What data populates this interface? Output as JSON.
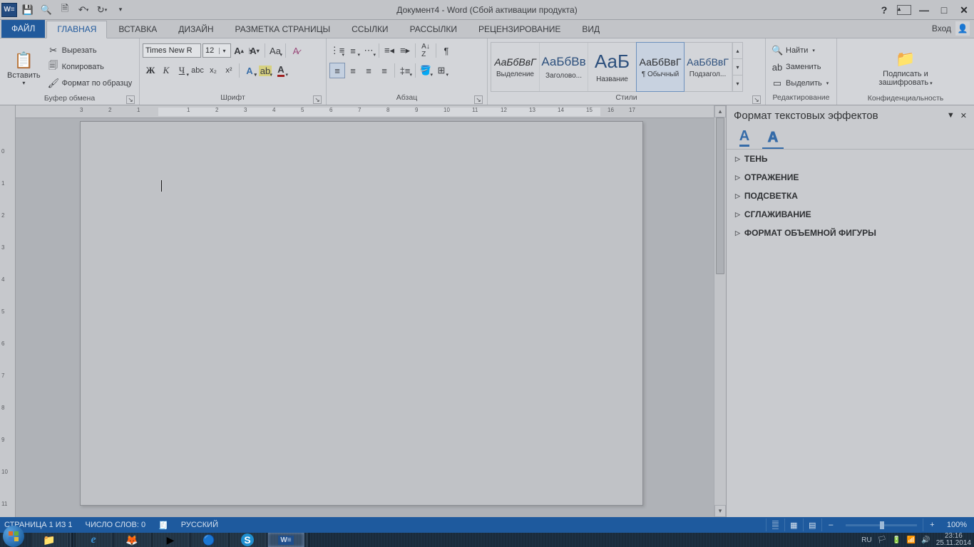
{
  "title": "Документ4 - Word (Сбой активации продукта)",
  "qat": {
    "save_tip": "Сохранить",
    "undo_tip": "Отменить",
    "redo_tip": "Повторить"
  },
  "tabs": {
    "file": "ФАЙЛ",
    "list": [
      "ГЛАВНАЯ",
      "ВСТАВКА",
      "ДИЗАЙН",
      "РАЗМЕТКА СТРАНИЦЫ",
      "ССЫЛКИ",
      "РАССЫЛКИ",
      "РЕЦЕНЗИРОВАНИЕ",
      "ВИД"
    ]
  },
  "login": "Вход",
  "ribbon": {
    "clipboard": {
      "label": "Буфер обмена",
      "paste": "Вставить",
      "cut": "Вырезать",
      "copy": "Копировать",
      "format_painter": "Формат по образцу"
    },
    "font": {
      "label": "Шрифт",
      "name": "Times New R",
      "size": "12"
    },
    "paragraph": {
      "label": "Абзац"
    },
    "styles": {
      "label": "Стили",
      "items": [
        {
          "preview": "АаБбВвГ",
          "name": "Выделение",
          "italic": true
        },
        {
          "preview": "АаБбВв",
          "name": "Заголово...",
          "big": true,
          "color": "#2c4f7c"
        },
        {
          "preview": "АаБ",
          "name": "Название",
          "huge": true,
          "color": "#2c4f7c"
        },
        {
          "preview": "АаБбВвГ",
          "name": "¶ Обычный",
          "selected": true
        },
        {
          "preview": "АаБбВвГ",
          "name": "Подзагол...",
          "color": "#2c4f7c"
        }
      ]
    },
    "editing": {
      "label": "Редактирование",
      "find": "Найти",
      "replace": "Заменить",
      "select": "Выделить"
    },
    "protect": {
      "label": "Конфиденциальность",
      "sign": "Подписать и",
      "encrypt": "зашифровать"
    }
  },
  "ruler": {
    "h_numbers": [
      "3",
      "2",
      "1",
      "1",
      "2",
      "3",
      "4",
      "5",
      "6",
      "7",
      "8",
      "9",
      "10",
      "11",
      "12",
      "13",
      "14",
      "15",
      "16",
      "17"
    ]
  },
  "taskpane": {
    "title": "Формат текстовых эффектов",
    "sections": [
      "ТЕНЬ",
      "ОТРАЖЕНИЕ",
      "ПОДСВЕТКА",
      "СГЛАЖИВАНИЕ",
      "ФОРМАТ ОБЪЕМНОЙ ФИГУРЫ"
    ]
  },
  "status": {
    "page": "СТРАНИЦА 1 ИЗ 1",
    "words": "ЧИСЛО СЛОВ: 0",
    "lang": "РУССКИЙ",
    "zoom": "100%"
  },
  "tray": {
    "lang": "RU",
    "time": "23:16",
    "date": "25.11.2014"
  }
}
